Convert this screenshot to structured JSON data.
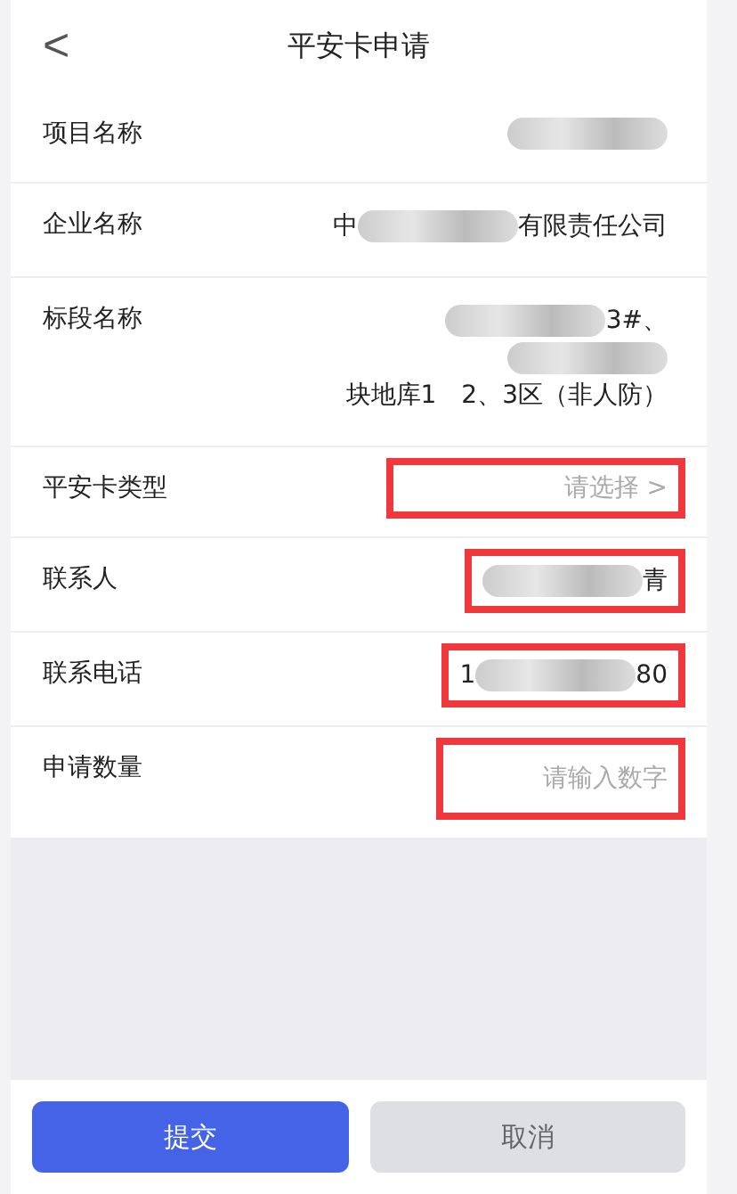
{
  "header": {
    "back": "<",
    "title": "平安卡申请"
  },
  "rows": [
    {
      "label": "项目名称",
      "kind": "text",
      "highlighted": false,
      "value": [
        {
          "kind": "redacted"
        }
      ]
    },
    {
      "label": "企业名称",
      "kind": "text",
      "highlighted": false,
      "value": [
        {
          "kind": "text",
          "text": "中"
        },
        {
          "kind": "redacted"
        },
        {
          "kind": "text",
          "text": "有限责任公司"
        }
      ]
    },
    {
      "label": "标段名称",
      "kind": "text",
      "highlighted": false,
      "value": [
        {
          "kind": "redacted"
        },
        {
          "kind": "text",
          "text": "3#、"
        },
        {
          "kind": "redacted"
        },
        {
          "kind": "text",
          "text": "块地库1　2、3区（非人防）"
        }
      ]
    },
    {
      "label": "平安卡类型",
      "kind": "select",
      "highlighted": true,
      "placeholder": "请选择",
      "arrow": ">"
    },
    {
      "label": "联系人",
      "kind": "text",
      "highlighted": true,
      "value": [
        {
          "kind": "redacted"
        },
        {
          "kind": "text",
          "text": "青"
        }
      ]
    },
    {
      "label": "联系电话",
      "kind": "text",
      "highlighted": true,
      "value": [
        {
          "kind": "text",
          "text": "1"
        },
        {
          "kind": "redacted"
        },
        {
          "kind": "text",
          "text": "80"
        }
      ]
    },
    {
      "label": "申请数量",
      "kind": "input",
      "highlighted": true,
      "placeholder": "请输入数字"
    }
  ],
  "buttons": [
    {
      "label": "提交",
      "primary": true
    },
    {
      "label": "取消",
      "primary": false
    }
  ]
}
